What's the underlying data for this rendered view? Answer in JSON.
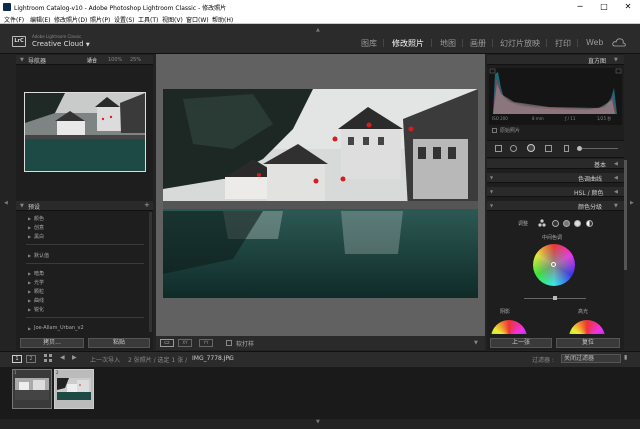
{
  "window": {
    "title": "Lightroom Catalog-v10 - Adobe Photoshop Lightroom Classic - 修改照片",
    "minimize": "─",
    "maximize": "□",
    "close": "✕"
  },
  "menu": [
    "文件(F)",
    "编辑(E)",
    "修改照片(D)",
    "照片(P)",
    "设置(S)",
    "工具(T)",
    "视图(V)",
    "窗口(W)",
    "帮助(H)"
  ],
  "identity": {
    "logo": "LrC",
    "line1": "Adobe Lightroom Classic",
    "line2": "Creative Cloud",
    "chevron": "▼"
  },
  "modules": [
    "图库",
    "修改照片",
    "地图",
    "画册",
    "幻灯片放映",
    "打印",
    "Web"
  ],
  "active_module": "修改照片",
  "navigator": {
    "title": "导航器",
    "zoom": [
      "适合",
      "100%",
      "25%"
    ]
  },
  "presets": {
    "title": "预设",
    "add": "+",
    "items": [
      "颜色",
      "创意",
      "黑白",
      "默认值",
      "暗角",
      "光学",
      "颗粒",
      "曲线",
      "锐化",
      "Joe-Allam_Urban_v2"
    ]
  },
  "left_buttons": [
    "拷贝...",
    "粘贴"
  ],
  "toolbar": {
    "view1": "▭",
    "view2": "XY",
    "view3": "YY",
    "softproof": "软打样"
  },
  "histogram": {
    "title": "直方图",
    "iso": "ISO 200",
    "focal": "8 mm",
    "aperture": "ƒ / 11",
    "shutter": "1/25 秒",
    "original": "原始照片"
  },
  "right_panels": {
    "basic": "基本",
    "tone_curve": "色调曲线",
    "hsl": "HSL / 颜色",
    "split": "颜色分级",
    "adjust": "调整",
    "midtones": "中间色调",
    "shadows": "阴影",
    "highlights": "高光"
  },
  "right_buttons": [
    "上一张",
    "复位"
  ],
  "filmstrip": {
    "page1": "1",
    "page2": "2",
    "prev_import": "上一次导入",
    "count": "2 张照片 / 选定 1 张 /",
    "filename": "IMG_7778.JPG",
    "filter_label": "过滤器 :",
    "filter_value": "关闭过滤器"
  },
  "colors": {
    "bg": "#232323",
    "panel": "#1e1e1e",
    "canvas": "#616161",
    "active": "#ffffff"
  }
}
